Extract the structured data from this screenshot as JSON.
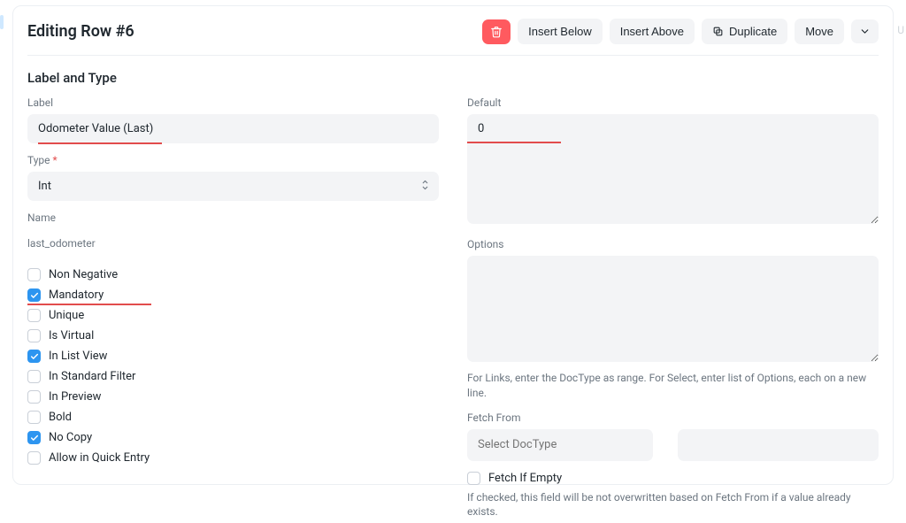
{
  "header": {
    "title": "Editing Row #6",
    "insert_below": "Insert Below",
    "insert_above": "Insert Above",
    "duplicate": "Duplicate",
    "move": "Move"
  },
  "section_title": "Label and Type",
  "left": {
    "label_label": "Label",
    "label_value": "Odometer Value (Last)",
    "type_label": "Type",
    "type_value": "Int",
    "name_label": "Name",
    "name_value": "last_odometer"
  },
  "checks": [
    {
      "key": "non_negative",
      "label": "Non Negative",
      "checked": false
    },
    {
      "key": "mandatory",
      "label": "Mandatory",
      "checked": true
    },
    {
      "key": "unique",
      "label": "Unique",
      "checked": false
    },
    {
      "key": "is_virtual",
      "label": "Is Virtual",
      "checked": false
    },
    {
      "key": "in_list_view",
      "label": "In List View",
      "checked": true
    },
    {
      "key": "in_std_filter",
      "label": "In Standard Filter",
      "checked": false
    },
    {
      "key": "in_preview",
      "label": "In Preview",
      "checked": false
    },
    {
      "key": "bold",
      "label": "Bold",
      "checked": false
    },
    {
      "key": "no_copy",
      "label": "No Copy",
      "checked": true
    },
    {
      "key": "allow_quick",
      "label": "Allow in Quick Entry",
      "checked": false
    }
  ],
  "right": {
    "default_label": "Default",
    "default_value": "0",
    "options_label": "Options",
    "options_value": "",
    "options_help": "For Links, enter the DocType as range. For Select, enter list of Options, each on a new line.",
    "fetch_from_label": "Fetch From",
    "fetch_from_placeholder": "Select DocType",
    "fetch_if_empty_label": "Fetch If Empty",
    "fetch_if_empty_checked": false,
    "fetch_if_empty_help": "If checked, this field will be not overwritten based on Fetch From if a value already exists."
  },
  "decor_letter": "U"
}
